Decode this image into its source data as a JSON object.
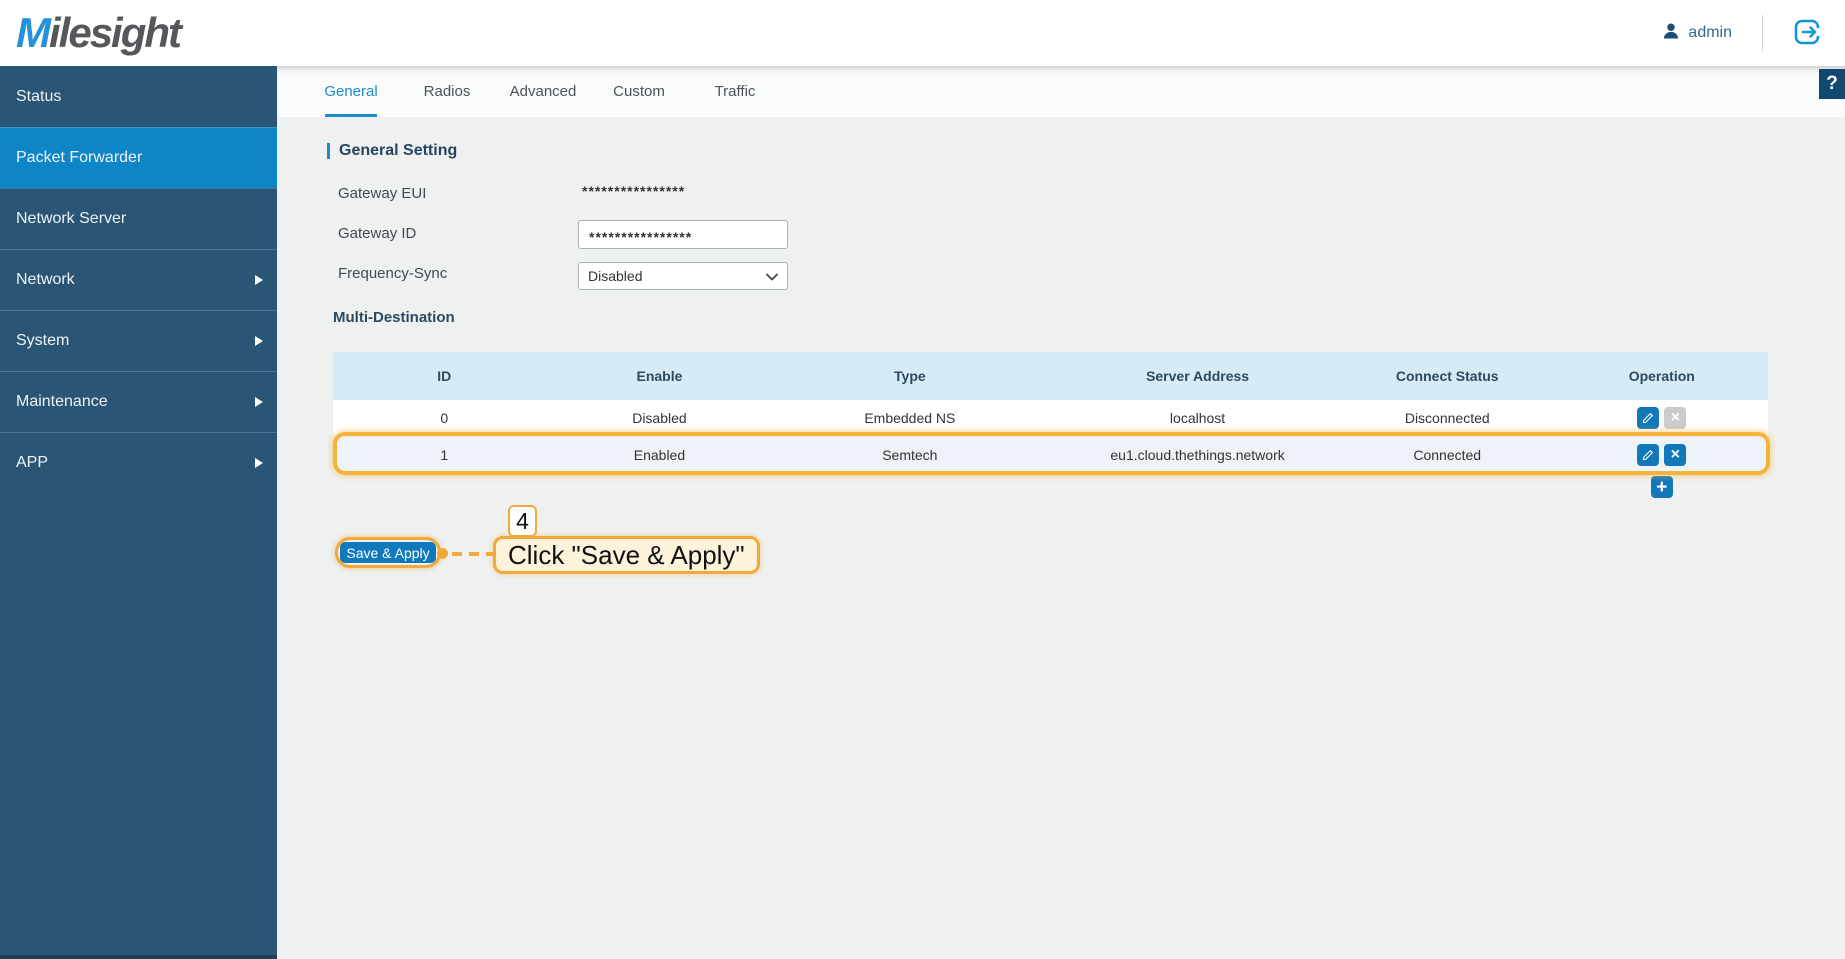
{
  "header": {
    "logo": "Milesight",
    "logo_accent": "M",
    "logo_rest": "ilesight",
    "username": "admin"
  },
  "help": {
    "label": "?"
  },
  "sidebar": {
    "items": [
      {
        "label": "Status",
        "active": false,
        "expandable": false
      },
      {
        "label": "Packet Forwarder",
        "active": true,
        "expandable": false
      },
      {
        "label": "Network Server",
        "active": false,
        "expandable": false
      },
      {
        "label": "Network",
        "active": false,
        "expandable": true
      },
      {
        "label": "System",
        "active": false,
        "expandable": true
      },
      {
        "label": "Maintenance",
        "active": false,
        "expandable": true
      },
      {
        "label": "APP",
        "active": false,
        "expandable": true
      }
    ]
  },
  "tabs": [
    {
      "label": "General",
      "active": true
    },
    {
      "label": "Radios",
      "active": false
    },
    {
      "label": "Advanced",
      "active": false
    },
    {
      "label": "Custom",
      "active": false
    },
    {
      "label": "Traffic",
      "active": false
    }
  ],
  "general_setting": {
    "title": "General Setting",
    "gateway_eui": {
      "label": "Gateway EUI",
      "value": "****************"
    },
    "gateway_id": {
      "label": "Gateway ID",
      "value": "****************"
    },
    "frequency_sync": {
      "label": "Frequency-Sync",
      "value": "Disabled"
    }
  },
  "multi_destination": {
    "title": "Multi-Destination",
    "columns": [
      "ID",
      "Enable",
      "Type",
      "Server Address",
      "Connect Status",
      "Operation"
    ],
    "rows": [
      {
        "id": "0",
        "enable": "Disabled",
        "type": "Embedded NS",
        "server_address": "localhost",
        "connect_status": "Disconnected",
        "delete_enabled": false,
        "highlighted": false
      },
      {
        "id": "1",
        "enable": "Enabled",
        "type": "Semtech",
        "server_address": "eu1.cloud.thethings.network",
        "connect_status": "Connected",
        "delete_enabled": true,
        "highlighted": true
      }
    ]
  },
  "actions": {
    "save_label": "Save & Apply"
  },
  "annotation": {
    "step": "4",
    "tooltip": "Click \"Save & Apply\""
  },
  "colors": {
    "accent_blue": "#0e85c6",
    "sidebar_bg": "#2b5574",
    "active_tab": "#1e8bc8",
    "annotation_orange": "#f2a93b",
    "table_header_bg": "#d7ebf6",
    "button_blue": "#0f79bb",
    "disabled_gray": "#c9cbcd"
  }
}
